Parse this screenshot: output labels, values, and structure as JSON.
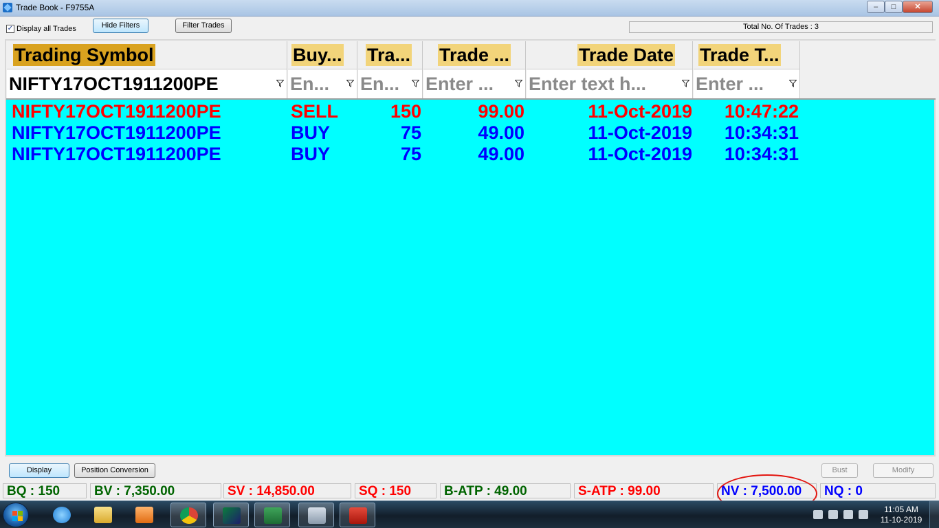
{
  "window": {
    "title": "Trade Book - F9755A",
    "minimize": "‒",
    "maximize": "□",
    "close": "✕"
  },
  "toolbar": {
    "display_all_checked": true,
    "check_mark": "✓",
    "display_all_label": "Display all Trades",
    "hide_filters_label": "Hide Filters",
    "filter_trades_label": "Filter Trades",
    "total_trades": "Total No. Of Trades : 3"
  },
  "grid": {
    "headers": [
      "Trading Symbol",
      "Buy...",
      "Tra...",
      "Trade ...",
      "Trade Date",
      "Trade T..."
    ],
    "filters": [
      "NIFTY17OCT1911200PE",
      "En...",
      "En...",
      "Enter ...",
      "Enter text h...",
      "Enter ..."
    ],
    "rows": [
      {
        "symbol": "NIFTY17OCT1911200PE",
        "side": "SELL",
        "qty": "150",
        "price": "99.00",
        "date": "11-Oct-2019",
        "time": "10:47:22",
        "color": "#ff0000"
      },
      {
        "symbol": "NIFTY17OCT1911200PE",
        "side": "BUY",
        "qty": "75",
        "price": "49.00",
        "date": "11-Oct-2019",
        "time": "10:34:31",
        "color": "#0000ff"
      },
      {
        "symbol": "NIFTY17OCT1911200PE",
        "side": "BUY",
        "qty": "75",
        "price": "49.00",
        "date": "11-Oct-2019",
        "time": "10:34:31",
        "color": "#0000ff"
      }
    ],
    "background": "#00ffff"
  },
  "buttons": {
    "display": "Display",
    "position_conversion": "Position Conversion",
    "bust": "Bust",
    "modify": "Modify"
  },
  "status": {
    "bq": "BQ : 150",
    "bv": "BV : 7,350.00",
    "sv": "SV : 14,850.00",
    "sq": "SQ : 150",
    "b_atp": "B-ATP : 49.00",
    "s_atp": "S-ATP : 99.00",
    "nv": "NV : 7,500.00",
    "nq": "NQ : 0"
  },
  "taskbar": {
    "apps": [
      "internet-explorer",
      "windows-explorer",
      "media-player",
      "chrome",
      "trading-terminal",
      "excel",
      "calculator",
      "acrobat"
    ],
    "clock_time": "11:05 AM",
    "clock_date": "11-10-2019"
  }
}
